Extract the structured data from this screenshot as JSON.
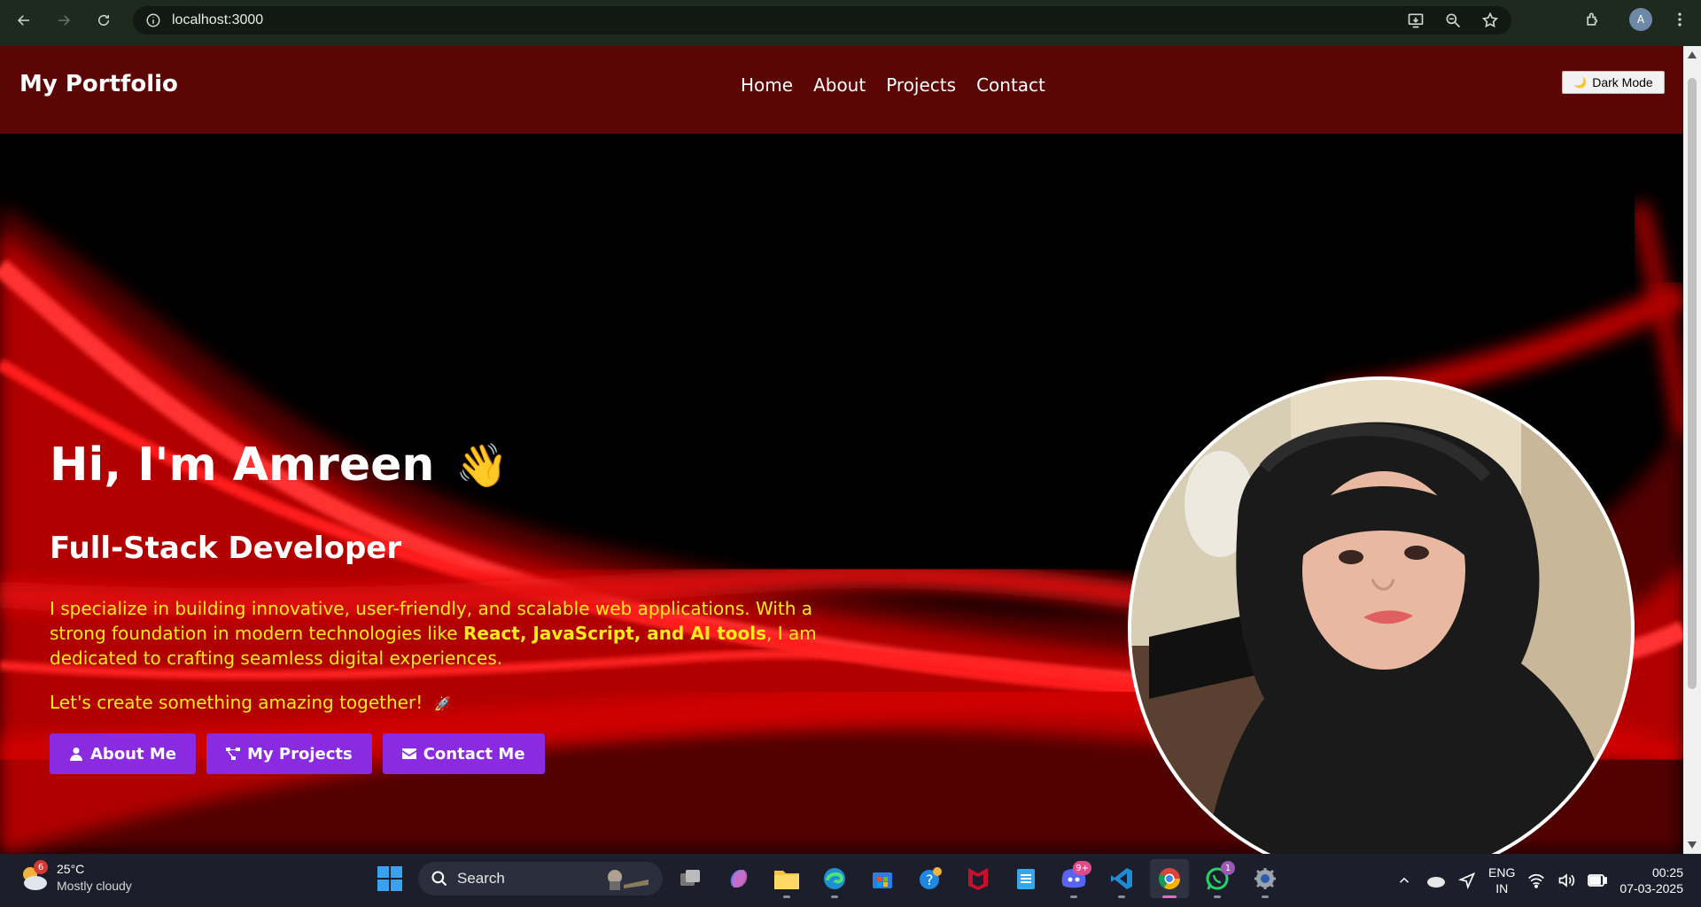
{
  "browser": {
    "url": "localhost:3000",
    "profile_initial": "A"
  },
  "navbar": {
    "brand": "My Portfolio",
    "links": [
      "Home",
      "About",
      "Projects",
      "Contact"
    ],
    "dark_mode_label": "Dark Mode",
    "dark_mode_icon": "🌙",
    "bg_color": "#5c0505"
  },
  "hero": {
    "greeting": "Hi, I'm Amreen",
    "wave_emoji": "👋",
    "role": "Full-Stack Developer",
    "desc_part1": "I specialize in building innovative, user-friendly, and scalable web applications. With a strong foundation in modern technologies like ",
    "desc_bold": "React, JavaScript, and AI tools",
    "desc_part2": ", I am dedicated to crafting seamless digital experiences.",
    "cta": "Let's create something amazing together!",
    "cta_emoji": "🚀",
    "buttons": [
      "About Me",
      "My Projects",
      "Contact Me"
    ],
    "accent_color": "#8a2be2",
    "text_color": "#ffeb1a"
  },
  "taskbar": {
    "weather_temp": "25°C",
    "weather_desc": "Mostly cloudy",
    "weather_badge": "6",
    "search_label": "Search",
    "discord_badge": "9+",
    "whatsapp_badge": "1",
    "lang_line1": "ENG",
    "lang_line2": "IN",
    "time": "00:25",
    "date": "07-03-2025"
  }
}
